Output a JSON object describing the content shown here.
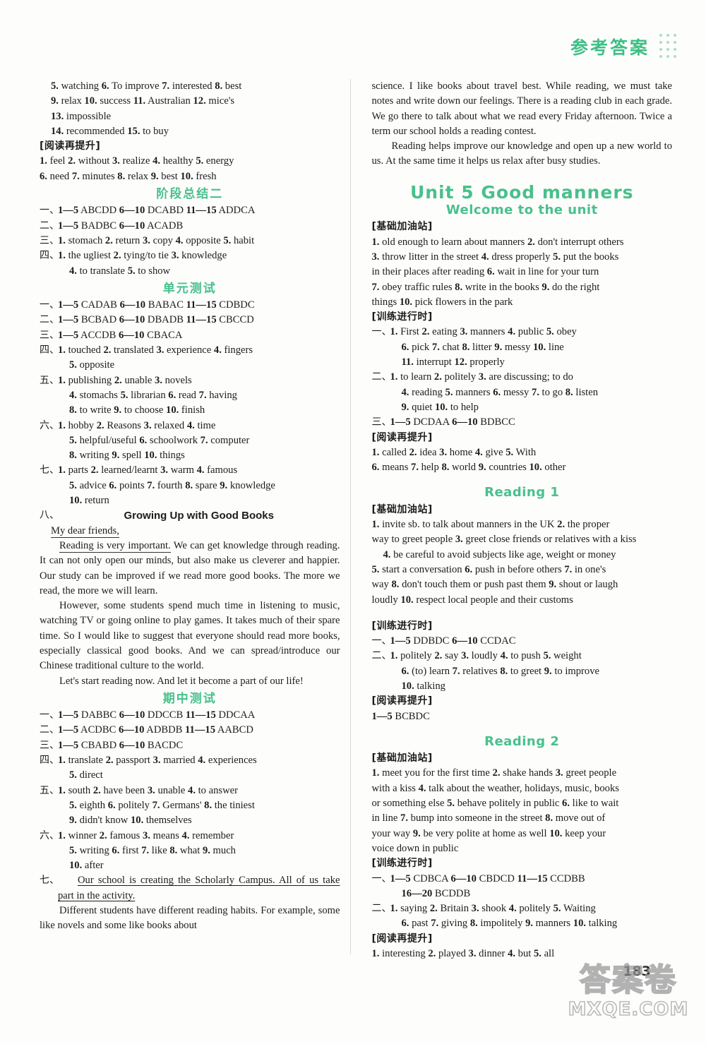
{
  "header": {
    "title": "参考答案"
  },
  "footer": {
    "page_number": "183",
    "watermark_cn": "答案卷",
    "watermark_en": "MXQE.COM"
  },
  "left_column": {
    "top_answers": [
      "5. watching   6. To improve   7. interested   8. best",
      "9. relax   10. success   11. Australian   12. mice's",
      "13. impossible",
      "14. recommended   15. to buy"
    ],
    "reading_label": "[阅读再提升]",
    "reading_answers": [
      "1. feel  2. without  3. realize  4. healthy  5. energy",
      "6. need  7. minutes  8. relax  9. best  10. fresh"
    ],
    "stage_summary_heading": "阶段总结二",
    "stage_summary": [
      {
        "marker": "一、",
        "lines": [
          "1—5 ABCDD   6—10 DCABD   11—15 ADDCA"
        ]
      },
      {
        "marker": "二、",
        "lines": [
          "1—5 BADBC   6—10 ACADB"
        ]
      },
      {
        "marker": "三、",
        "lines": [
          "1. stomach  2. return  3. copy  4. opposite  5. habit"
        ]
      },
      {
        "marker": "四、",
        "lines": [
          "1. the ugliest   2. tying/to tie   3. knowledge",
          "4. to translate   5. to show"
        ]
      }
    ],
    "unit_test_heading": "单元测试",
    "unit_test": [
      {
        "marker": "一、",
        "lines": [
          "1—5 CADAB   6—10 BABAC   11—15 CDBDC"
        ]
      },
      {
        "marker": "二、",
        "lines": [
          "1—5 BCBAD   6—10 DBADB   11—15 CBCCD"
        ]
      },
      {
        "marker": "三、",
        "lines": [
          "1—5 ACCDB   6—10 CBACA"
        ]
      },
      {
        "marker": "四、",
        "lines": [
          "1. touched   2. translated   3. experience   4. fingers",
          "5. opposite"
        ]
      },
      {
        "marker": "五、",
        "lines": [
          "1. publishing   2. unable   3. novels",
          "4. stomachs   5. librarian   6. read   7. having",
          "8. to write   9. to choose   10. finish"
        ]
      },
      {
        "marker": "六、",
        "lines": [
          "1. hobby   2. Reasons   3. relaxed   4. time",
          "5. helpful/useful   6. schoolwork   7. computer",
          "8. writing   9. spell   10. things"
        ]
      },
      {
        "marker": "七、",
        "lines": [
          "1. parts   2. learned/learnt   3. warm   4. famous",
          "5. advice  6. points  7. fourth  8. spare  9. knowledge",
          "10. return"
        ]
      }
    ],
    "essay": {
      "marker": "八、",
      "title": "Growing Up with Good Books",
      "salutation": "My dear friends,",
      "para1_underlined": "Reading is very important.",
      "para1_rest": "We can get knowledge through reading. It can not only open our minds, but also make us cleverer and happier. Our study can be improved if we read more good books. The more we read, the more we will learn.",
      "para2": "However, some students spend much time in listening to music, watching TV or going online to play games. It takes much of their spare time. So I would like to suggest that everyone should read more books, especially classical good books. And we can spread/introduce our Chinese traditional culture to the world.",
      "para3": "Let's start reading now. And let it become a part of our life!"
    },
    "midterm_heading": "期中测试",
    "midterm": [
      {
        "marker": "一、",
        "lines": [
          "1—5 DABBC   6—10 DDCCB   11—15 DDCAA"
        ]
      },
      {
        "marker": "二、",
        "lines": [
          "1—5 ACDBC   6—10 ADBDB   11—15 AABCD"
        ]
      },
      {
        "marker": "三、",
        "lines": [
          "1—5 CBABD   6—10 BACDC"
        ]
      },
      {
        "marker": "四、",
        "lines": [
          "1. translate   2. passport   3. married   4. experiences",
          "5. direct"
        ]
      },
      {
        "marker": "五、",
        "lines": [
          "1. south   2. have been   3. unable   4. to answer",
          "5. eighth   6. politely   7. Germans'   8. the tiniest",
          "9. didn't know   10. themselves"
        ]
      },
      {
        "marker": "六、",
        "lines": [
          "1. winner   2. famous   3. means   4. remember",
          "5. writing   6. first   7. like   8. what   9. much",
          "10. after"
        ]
      }
    ],
    "midterm_essay": {
      "marker": "七、",
      "underlined": "Our school is creating the Scholarly Campus. All of us take part in the activity.",
      "para_tail": "Different students have different reading habits. For example, some like novels and some like books about"
    }
  },
  "right_column": {
    "essay_continued_1": "science. I like books about travel best. While reading, we must take notes and write down our feelings. There is a reading club in each grade. We go there to talk about what we read every Friday afternoon. Twice a term our school holds a reading contest.",
    "essay_continued_2": "Reading helps improve our knowledge and open up a new world to us. At the same time it helps us relax after busy studies.",
    "unit_heading": "Unit 5    Good manners",
    "welcome_heading": "Welcome to the unit",
    "basics_label": "[基础加油站]",
    "training_label": "[训练进行时]",
    "reading_label": "[阅读再提升]",
    "welcome_basics": [
      "1. old enough to learn about manners   2. don't interrupt others",
      "3. throw litter in the street   4. dress properly   5. put the books",
      "in their places after reading   6. wait in line for your turn",
      "7. obey traffic rules   8. write in the books   9. do the right",
      "things   10. pick flowers in the park"
    ],
    "welcome_training": [
      {
        "marker": "一、",
        "lines": [
          "1. First  2. eating  3. manners  4. public  5. obey",
          "6. pick  7. chat  8. litter  9. messy  10. line",
          "11. interrupt  12. properly"
        ]
      },
      {
        "marker": "二、",
        "lines": [
          "1. to learn  2. politely  3. are discussing; to do",
          "4. reading  5. manners  6. messy  7. to go  8. listen",
          "9. quiet  10. to help"
        ]
      },
      {
        "marker": "三、",
        "lines": [
          "1—5 DCDAA   6—10 BDBCC"
        ]
      }
    ],
    "welcome_reading": [
      "1. called   2. idea   3. home   4. give   5. With",
      "6. means   7. help   8. world   9. countries   10. other"
    ],
    "reading1_heading": "Reading 1",
    "reading1_basics": [
      "1. invite sb. to talk about manners in the UK     2. the proper",
      "way to greet people   3. greet close friends or relatives with a kiss",
      "4. be careful to avoid subjects like age, weight or money",
      "5. start a conversation   6. push in before others   7. in one's",
      "way   8. don't touch them or push past them   9. shout or laugh",
      "loudly   10. respect local people and their customs"
    ],
    "reading1_training": [
      {
        "marker": "一、",
        "lines": [
          "1—5 DDBDC   6—10 CCDAC"
        ]
      },
      {
        "marker": "二、",
        "lines": [
          "1. politely   2. say   3. loudly   4. to push   5. weight",
          "6. (to) learn   7. relatives   8. to greet   9. to improve",
          "10. talking"
        ]
      }
    ],
    "reading1_reading": [
      "1—5   BCBDC"
    ],
    "reading2_heading": "Reading 2",
    "reading2_basics": [
      "1. meet you for the first time   2. shake hands   3. greet people",
      "with a kiss   4. talk about the weather, holidays, music, books",
      "or something else   5. behave politely in public   6. like to wait",
      "in line   7. bump into someone in the street   8. move out of",
      "your way   9. be very polite at home as well   10. keep your",
      "voice down in public"
    ],
    "reading2_training": [
      {
        "marker": "一、",
        "lines": [
          "1—5 CDBCA     6—10 CBDCD     11—15 CCDBB",
          "16—20 BCDDB"
        ]
      },
      {
        "marker": "二、",
        "lines": [
          "1. saying  2. Britain  3. shook  4. politely  5. Waiting",
          "6. past  7. giving  8. impolitely  9. manners  10. talking"
        ]
      }
    ],
    "reading2_reading": [
      "1. interesting   2. played   3. dinner   4. but   5. all"
    ]
  }
}
